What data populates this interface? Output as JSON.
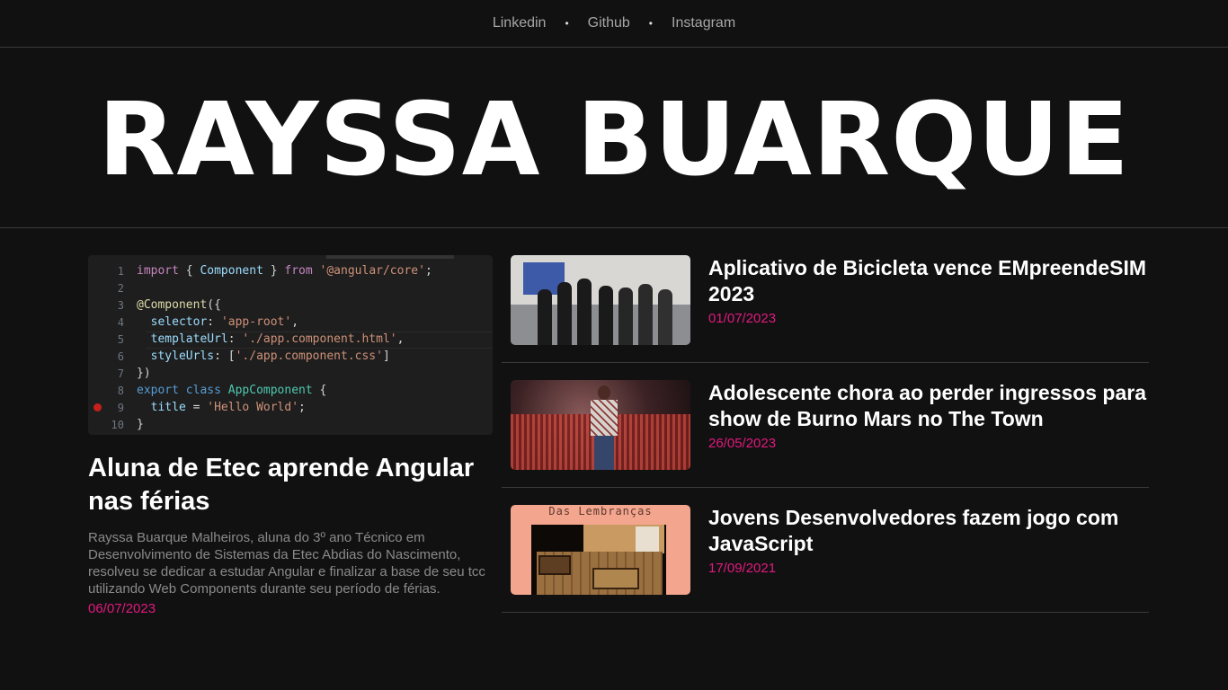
{
  "nav": {
    "links": [
      "Linkedin",
      "Github",
      "Instagram"
    ],
    "separator": "•"
  },
  "masthead": {
    "title": "RAYSSA BUARQUE"
  },
  "main_story": {
    "image_icon": "code-editor-screenshot",
    "code_lines": [
      {
        "n": "1",
        "text": "import { Component } from '@angular/core';"
      },
      {
        "n": "2",
        "text": ""
      },
      {
        "n": "3",
        "text": "@Component({"
      },
      {
        "n": "4",
        "text": "  selector: 'app-root',"
      },
      {
        "n": "5",
        "text": "  templateUrl: './app.component.html',"
      },
      {
        "n": "6",
        "text": "  styleUrls: ['./app.component.css']"
      },
      {
        "n": "7",
        "text": "})"
      },
      {
        "n": "8",
        "text": "export class AppComponent {"
      },
      {
        "n": "9",
        "text": "  title = 'Hello World';"
      },
      {
        "n": "10",
        "text": "}"
      }
    ],
    "title": "Aluna de Etec aprende Angular nas férias",
    "description": "Rayssa Buarque Malheiros, aluna do 3º ano Técnico em Desenvolvimento de Sistemas da Etec Abdias do Nascimento, resolveu se dedicar a estudar Angular e finalizar a base de seu tcc utilizando Web Components durante seu período de férias.",
    "date": "06/07/2023"
  },
  "side_stories": [
    {
      "title": "Aplicativo de Bicicleta vence EMpreendeSIM 2023",
      "date": "01/07/2023",
      "image_icon": "group-photo"
    },
    {
      "title": "Adolescente chora ao perder ingressos para show de Burno Mars no The Town",
      "date": "26/05/2023",
      "image_icon": "concert-photo"
    },
    {
      "title": "Jovens Desenvolvedores fazem jogo com JavaScript",
      "date": "17/09/2021",
      "image_icon": "game-screenshot",
      "thumb_caption": "Das Lembranças"
    }
  ],
  "colors": {
    "background": "#121112",
    "accent": "#e0197d",
    "text_muted": "#8a8a8a"
  }
}
